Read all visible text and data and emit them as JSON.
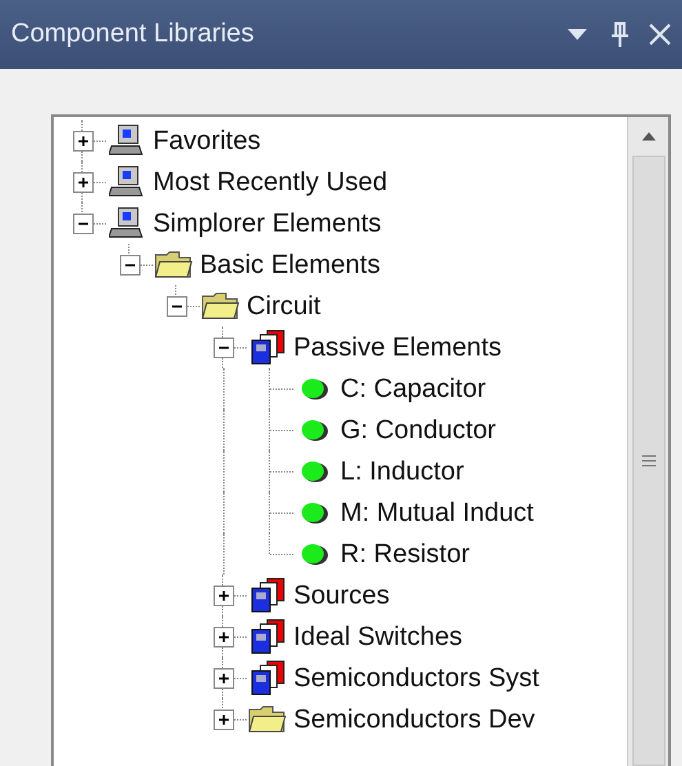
{
  "panel": {
    "title": "Component Libraries"
  },
  "tree": [
    {
      "label": "Favorites",
      "kind": "computer",
      "expanded": false
    },
    {
      "label": "Most Recently Used",
      "kind": "computer",
      "expanded": false
    },
    {
      "label": "Simplorer Elements",
      "kind": "computer",
      "expanded": true,
      "children": [
        {
          "label": "Basic Elements",
          "kind": "folder",
          "expanded": true,
          "children": [
            {
              "label": "Circuit",
              "kind": "folder",
              "expanded": true,
              "children": [
                {
                  "label": "Passive Elements",
                  "kind": "library",
                  "expanded": true,
                  "children": [
                    {
                      "label": "C: Capacitor",
                      "kind": "component"
                    },
                    {
                      "label": "G: Conductor",
                      "kind": "component"
                    },
                    {
                      "label": "L: Inductor",
                      "kind": "component"
                    },
                    {
                      "label": "M: Mutual Induct",
                      "kind": "component"
                    },
                    {
                      "label": "R: Resistor",
                      "kind": "component"
                    }
                  ]
                },
                {
                  "label": "Sources",
                  "kind": "library",
                  "expanded": false
                },
                {
                  "label": "Ideal Switches",
                  "kind": "library",
                  "expanded": false
                },
                {
                  "label": "Semiconductors Syst",
                  "kind": "library",
                  "expanded": false
                },
                {
                  "label": "Semiconductors Dev",
                  "kind": "folder",
                  "expanded": false
                }
              ]
            }
          ]
        }
      ]
    }
  ]
}
